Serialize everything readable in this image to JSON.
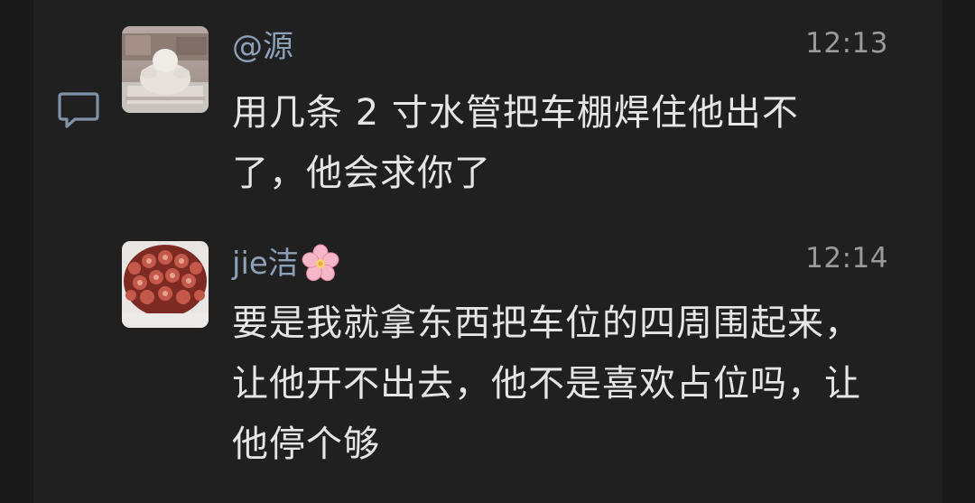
{
  "comments": [
    {
      "username": "@源",
      "time": "12:13",
      "text": "用几条 2 寸水管把车棚焊住他出不了，他会求你了",
      "avatar_icon": "laughing-buddha-statue-avatar",
      "reply_icon": "comment-bubble-icon"
    },
    {
      "username": "jie洁",
      "username_emoji": "cherry-blossom-icon",
      "time": "12:14",
      "text": "要是我就拿东西把车位的四周围起来，让他开不出去，他不是喜欢占位吗，让他停个够",
      "avatar_icon": "rose-bouquet-avatar"
    }
  ],
  "colors": {
    "background": "#191919",
    "panel": "#202020",
    "username": "#8d9fb6",
    "timestamp": "#9a9a9a",
    "text": "#e6e6e6"
  }
}
